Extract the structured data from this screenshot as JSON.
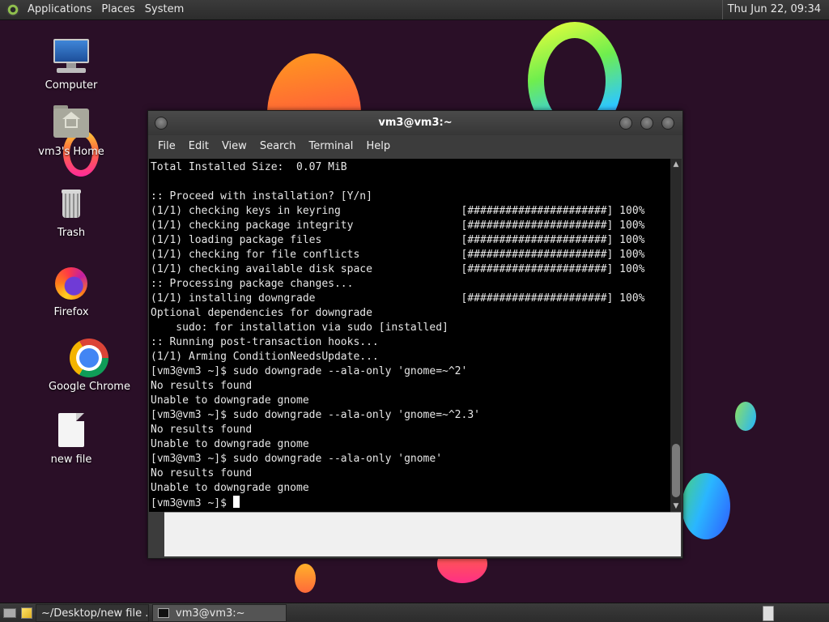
{
  "top_panel": {
    "menus": [
      "Applications",
      "Places",
      "System"
    ],
    "clock": "Thu Jun 22, 09:34"
  },
  "desktop": {
    "icons": [
      {
        "label": "Computer",
        "icon": "computer-icon"
      },
      {
        "label": "vm3's Home",
        "icon": "home-folder-icon"
      },
      {
        "label": "Trash",
        "icon": "trash-icon"
      },
      {
        "label": "Firefox",
        "icon": "firefox-icon"
      },
      {
        "label": "Google Chrome",
        "icon": "chrome-icon"
      },
      {
        "label": "new file",
        "icon": "file-icon"
      }
    ]
  },
  "terminal": {
    "title": "vm3@vm3:~",
    "menu": [
      "File",
      "Edit",
      "View",
      "Search",
      "Terminal",
      "Help"
    ],
    "lines": [
      "Total Installed Size:  0.07 MiB",
      "",
      ":: Proceed with installation? [Y/n]",
      "(1/1) checking keys in keyring                   [######################] 100%",
      "(1/1) checking package integrity                 [######################] 100%",
      "(1/1) loading package files                      [######################] 100%",
      "(1/1) checking for file conflicts                [######################] 100%",
      "(1/1) checking available disk space              [######################] 100%",
      ":: Processing package changes...",
      "(1/1) installing downgrade                       [######################] 100%",
      "Optional dependencies for downgrade",
      "    sudo: for installation via sudo [installed]",
      ":: Running post-transaction hooks...",
      "(1/1) Arming ConditionNeedsUpdate...",
      "[vm3@vm3 ~]$ sudo downgrade --ala-only 'gnome=~^2'",
      "No results found",
      "Unable to downgrade gnome",
      "[vm3@vm3 ~]$ sudo downgrade --ala-only 'gnome=~^2.3'",
      "No results found",
      "Unable to downgrade gnome",
      "[vm3@vm3 ~]$ sudo downgrade --ala-only 'gnome'",
      "No results found",
      "Unable to downgrade gnome"
    ],
    "prompt": "[vm3@vm3 ~]$ "
  },
  "taskbar": {
    "tasks": [
      {
        "label": "~/Desktop/new file ...",
        "icon": "text-editor-icon"
      },
      {
        "label": "vm3@vm3:~",
        "icon": "terminal-icon"
      }
    ]
  }
}
